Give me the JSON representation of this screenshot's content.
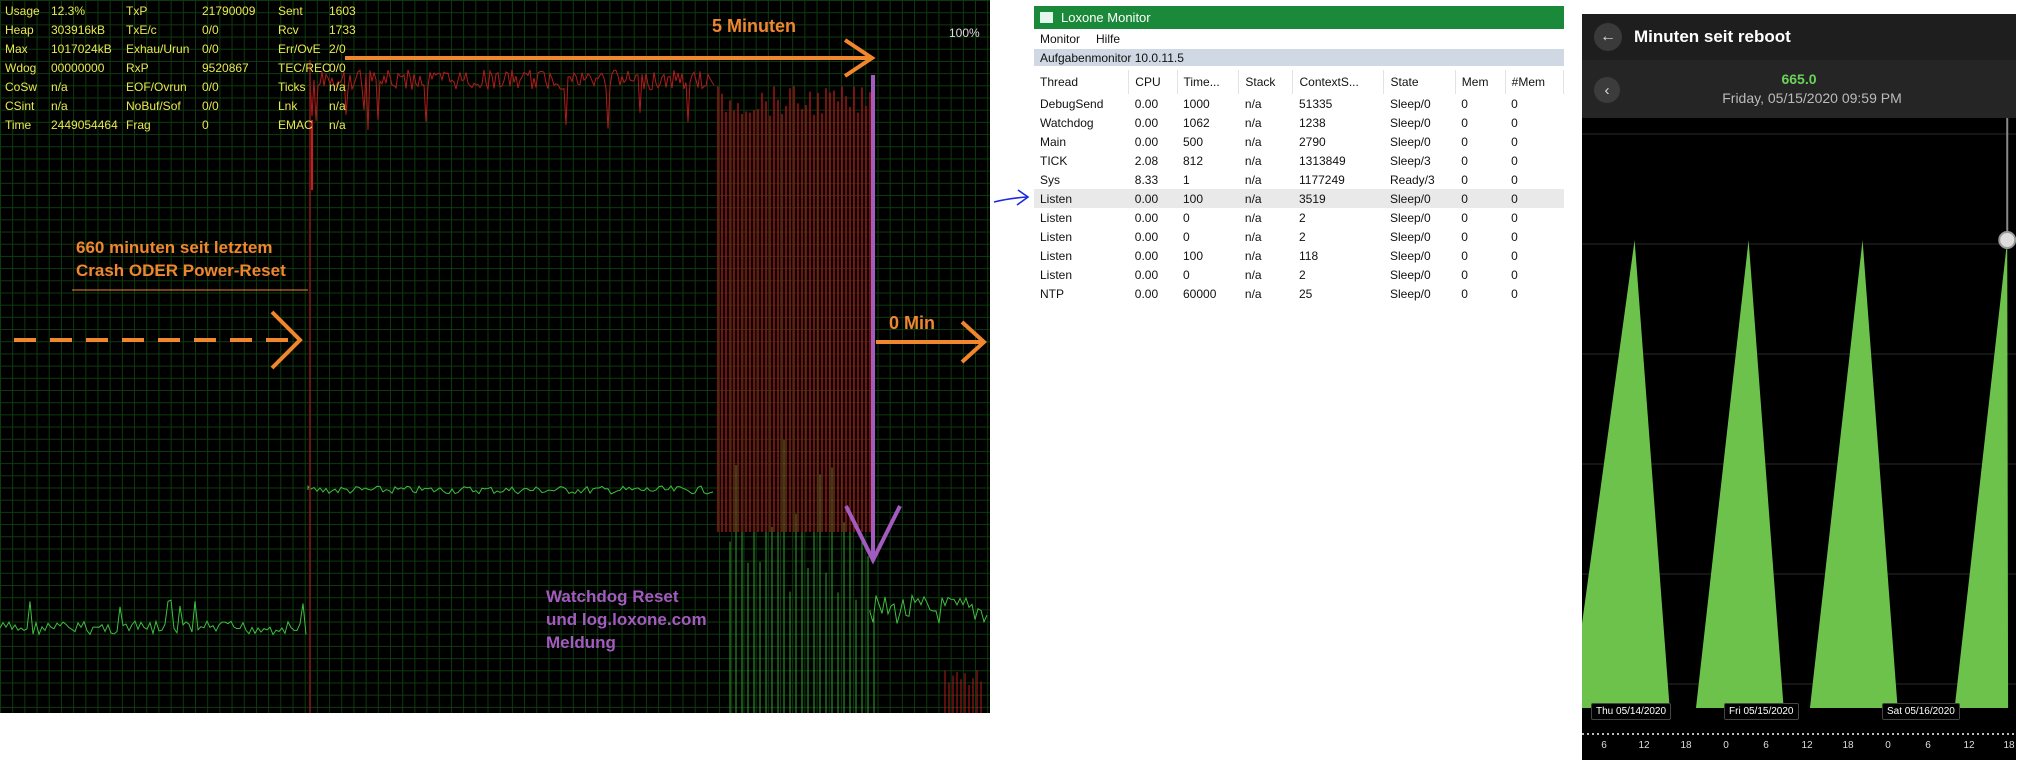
{
  "monitor": {
    "stats": [
      [
        "Usage",
        "12.3%",
        "TxP",
        "21790009",
        "Sent",
        "1603"
      ],
      [
        "Heap",
        "303916kB",
        "TxE/c",
        "0/0",
        "Rcv",
        "1733"
      ],
      [
        "Max",
        "1017024kB",
        "Exhau/Urun",
        "0/0",
        "Err/OvE",
        "2/0"
      ],
      [
        "Wdog",
        "00000000",
        "RxP",
        "9520867",
        "TEC/REC",
        "0/0"
      ],
      [
        "CoSw",
        "n/a",
        "EOF/Ovrun",
        "0/0",
        "Ticks",
        "n/a"
      ],
      [
        "CSint",
        "n/a",
        "NoBuf/Sof",
        "0/0",
        "Lnk",
        "n/a"
      ],
      [
        "Time",
        "2449054464",
        "Frag",
        "0",
        "EMAC",
        "n/a"
      ]
    ],
    "percent": "100%"
  },
  "annotations": {
    "five_min": "5 Minuten",
    "crash_line1": "660 minuten seit letztem",
    "crash_line2": "Crash ODER Power-Reset",
    "zero_min": "0 Min",
    "watchdog_line1": "Watchdog Reset",
    "watchdog_line2": "und log.loxone.com",
    "watchdog_line3": "Meldung"
  },
  "loxone_window": {
    "title": "Loxone Monitor",
    "menu": [
      "Monitor",
      "Hilfe"
    ],
    "subtitle": "Aufgabenmonitor 10.0.11.5",
    "columns": [
      "Thread",
      "CPU",
      "Time...",
      "Stack",
      "ContextS...",
      "State",
      "Mem",
      "#Mem"
    ],
    "rows": [
      [
        "DebugSend",
        "0.00",
        "1000",
        "n/a",
        "51335",
        "Sleep/0",
        "0",
        "0"
      ],
      [
        "Watchdog",
        "0.00",
        "1062",
        "n/a",
        "1238",
        "Sleep/0",
        "0",
        "0"
      ],
      [
        "Main",
        "0.00",
        "500",
        "n/a",
        "2790",
        "Sleep/0",
        "0",
        "0"
      ],
      [
        "TICK",
        "2.08",
        "812",
        "n/a",
        "1313849",
        "Sleep/3",
        "0",
        "0"
      ],
      [
        "Sys",
        "8.33",
        "1",
        "n/a",
        "1177249",
        "Ready/3",
        "0",
        "0"
      ],
      [
        "Listen",
        "0.00",
        "100",
        "n/a",
        "3519",
        "Sleep/0",
        "0",
        "0"
      ],
      [
        "Listen",
        "0.00",
        "0",
        "n/a",
        "2",
        "Sleep/0",
        "0",
        "0"
      ],
      [
        "Listen",
        "0.00",
        "0",
        "n/a",
        "2",
        "Sleep/0",
        "0",
        "0"
      ],
      [
        "Listen",
        "0.00",
        "100",
        "n/a",
        "118",
        "Sleep/0",
        "0",
        "0"
      ],
      [
        "Listen",
        "0.00",
        "0",
        "n/a",
        "2",
        "Sleep/0",
        "0",
        "0"
      ],
      [
        "NTP",
        "0.00",
        "60000",
        "n/a",
        "25",
        "Sleep/0",
        "0",
        "0"
      ]
    ],
    "selected_row": 5
  },
  "phone": {
    "title": "Minuten seit reboot",
    "value": "665.0",
    "datetime": "Friday, 05/15/2020 09:59 PM",
    "date_labels": [
      "Thu 05/14/2020",
      "Fri 05/15/2020",
      "Sat 05/16/2020"
    ],
    "tick_labels": [
      "6",
      "12",
      "18",
      "0",
      "6",
      "12",
      "18",
      "0",
      "6",
      "12",
      "18"
    ],
    "colors": {
      "fill": "#6cc24a",
      "value": "#6bd35a"
    }
  },
  "chart_data": {
    "type": "area",
    "title": "Minuten seit reboot",
    "x_ticks": [
      "6",
      "12",
      "18",
      "0",
      "6",
      "12",
      "18",
      "0",
      "6",
      "12",
      "18"
    ],
    "date_labels": [
      "Thu 05/14/2020",
      "Fri 05/15/2020",
      "Sat 05/16/2020"
    ],
    "series": [
      {
        "points": [
          [
            0,
            120
          ],
          [
            0.6,
            665
          ],
          [
            1.0,
            0
          ],
          [
            1.3,
            0
          ],
          [
            1.9,
            665
          ],
          [
            2.3,
            0
          ],
          [
            2.6,
            0
          ],
          [
            3.2,
            665
          ],
          [
            3.6,
            0
          ],
          [
            4.25,
            0
          ],
          [
            4.85,
            665
          ],
          [
            4.86,
            0
          ]
        ]
      }
    ],
    "cursor_value": 665.0
  }
}
